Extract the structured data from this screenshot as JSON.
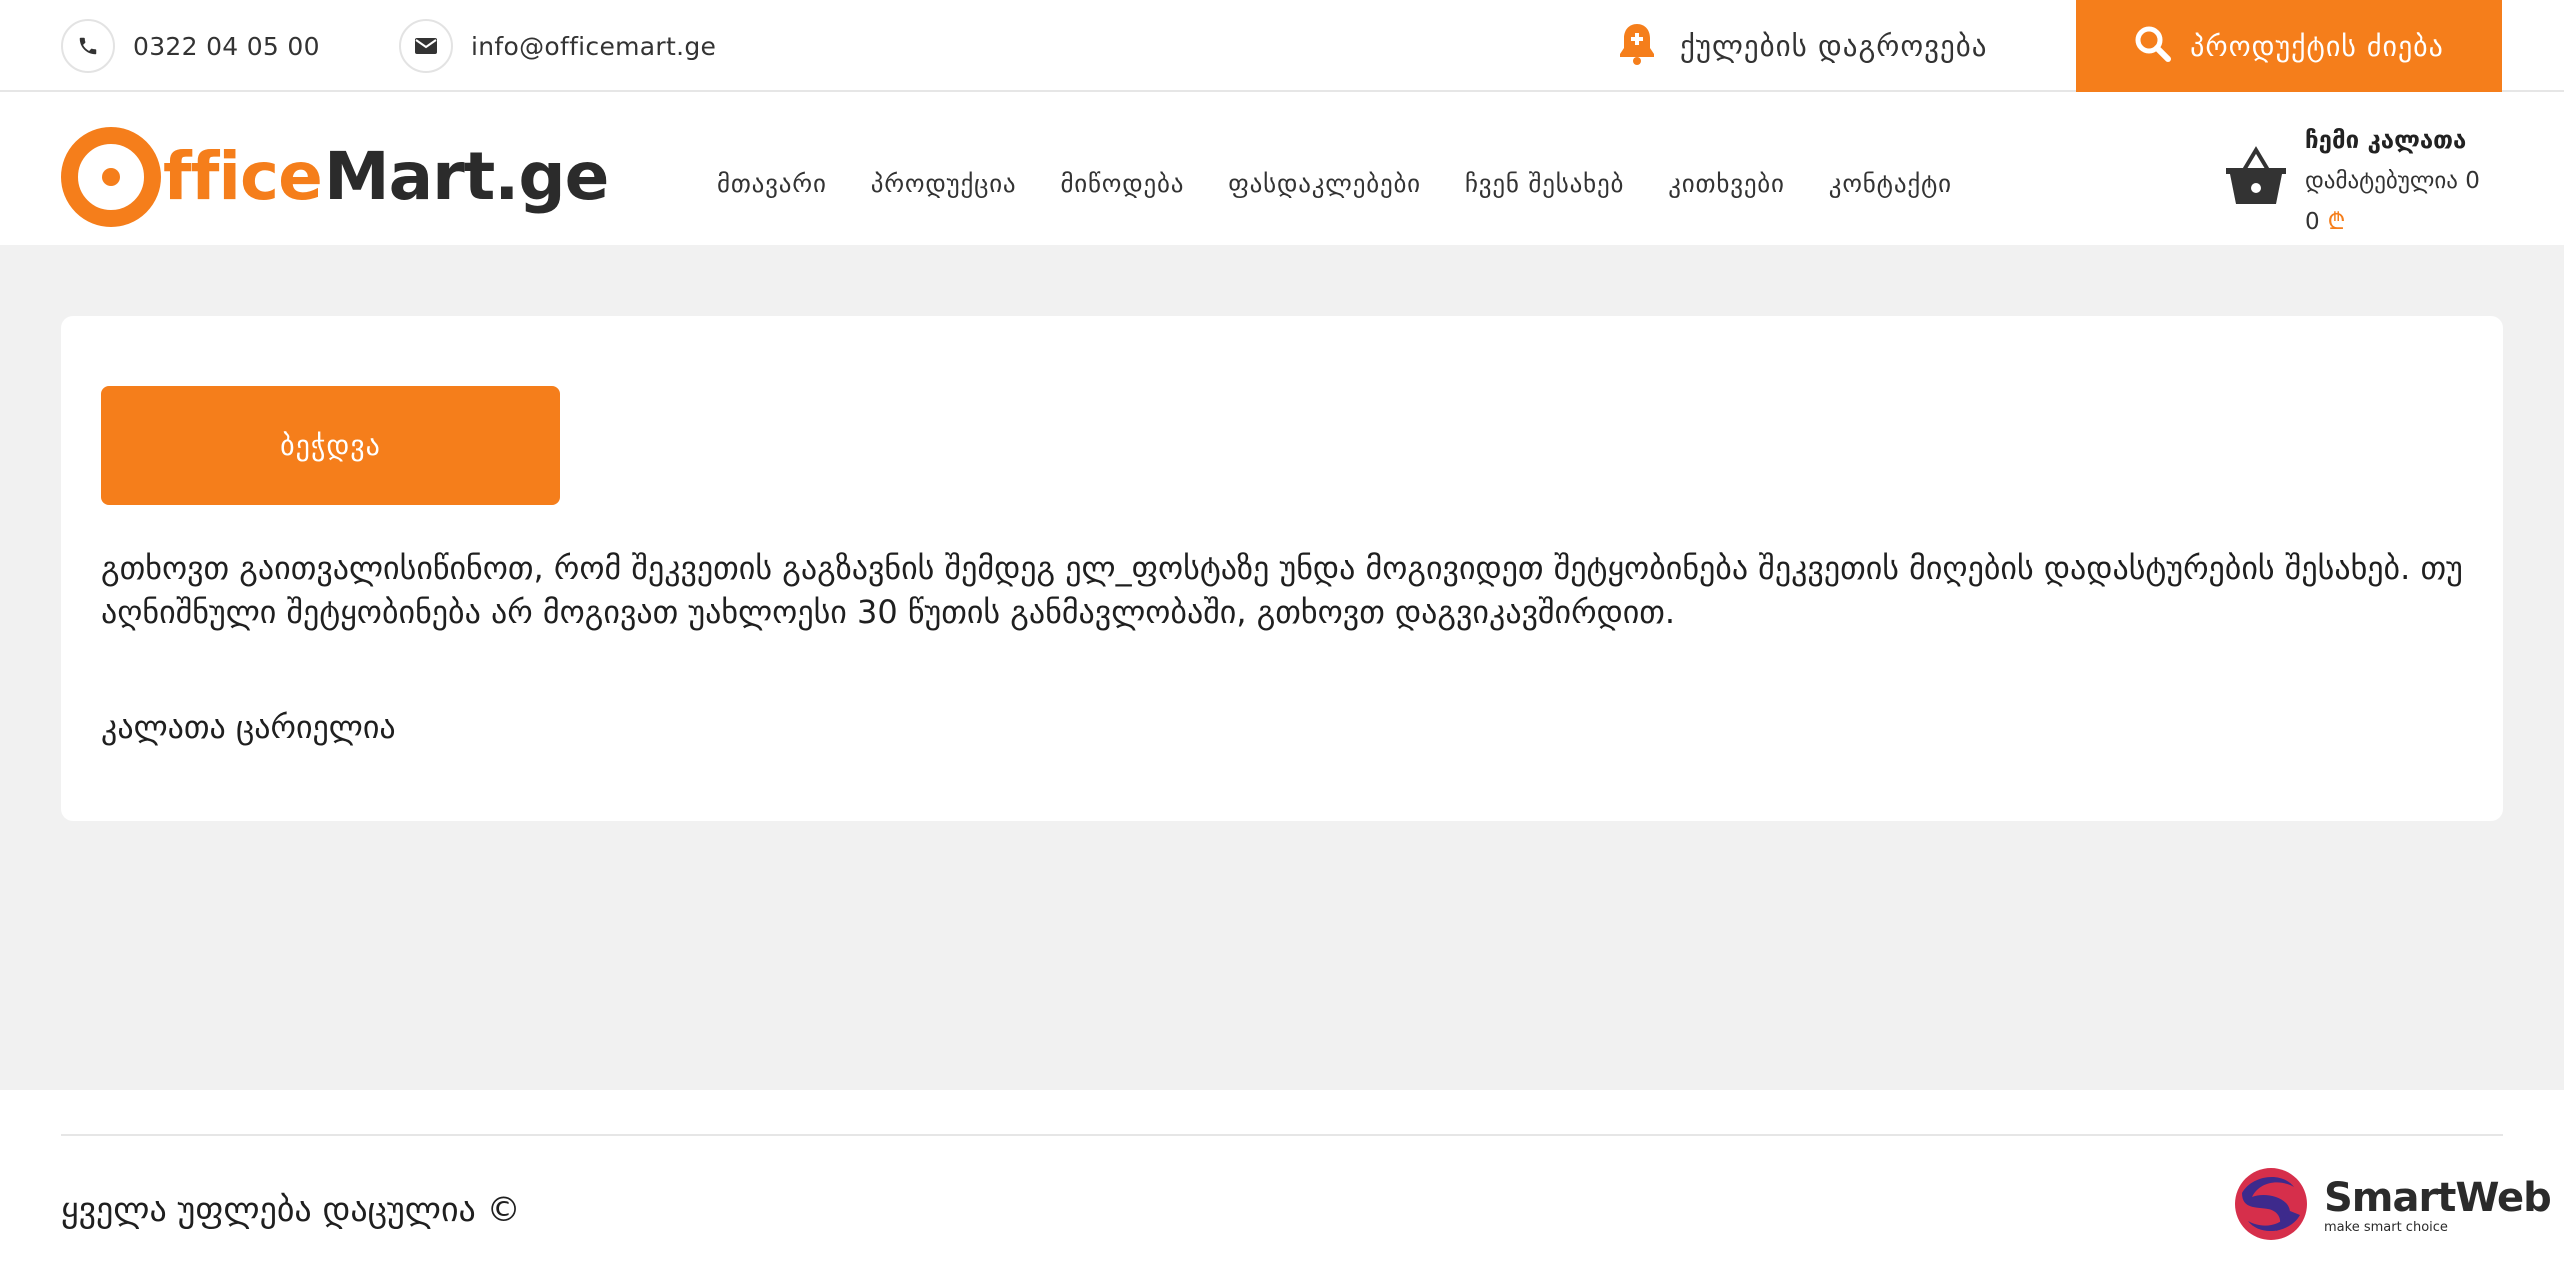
{
  "topbar": {
    "phone": "0322 04 05 00",
    "email": "info@officemart.ge",
    "points_label": "ქულების დაგროვება",
    "search_label": "პროდუქტის ძიება"
  },
  "logo": {
    "part1": "fficeMart",
    "part2": ".ge",
    "part_accent": "ffice",
    "part_dark": "Mart.ge"
  },
  "nav": {
    "items": [
      {
        "label": "მთავარი"
      },
      {
        "label": "პროდუქცია"
      },
      {
        "label": "მიწოდება"
      },
      {
        "label": "ფასდაკლებები"
      },
      {
        "label": "ჩვენ შესახებ"
      },
      {
        "label": "კითხვები"
      },
      {
        "label": "კონტაქტი"
      }
    ]
  },
  "cart": {
    "title": "ჩემი კალათა",
    "added": "დამატებულია 0",
    "sum": "0",
    "currency": "₾"
  },
  "main": {
    "print_label": "ბეჭდვა",
    "notice": "გთხოვთ გაითვალისიწინოთ, რომ შეკვეთის გაგზავნის შემდეგ ელ_ფოსტაზე უნდა მოგივიდეთ შეტყობინება შეკვეთის მიღების დადასტურების შესახებ. თუ აღნიშნული შეტყობინება არ მოგივათ უახლოესი 30 წუთის განმავლობაში, გთხოვთ დაგვიკავშირდით.",
    "empty_cart": "კალათა ცარიელია"
  },
  "footer": {
    "rights": "ყველა უფლება დაცულია ©",
    "partner_name": "SmartWeb",
    "partner_tagline": "make smart choice"
  },
  "colors": {
    "accent": "#f57e1b",
    "dark": "#2b2b2b",
    "background": "#f1f1f1"
  },
  "icons": [
    "phone-icon",
    "mail-icon",
    "bell-plus-icon",
    "search-icon",
    "basket-icon",
    "lari-icon",
    "smartweb-logo-icon"
  ]
}
